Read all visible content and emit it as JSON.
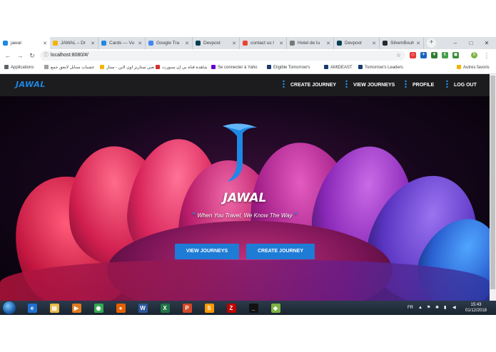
{
  "browser": {
    "tabs": [
      {
        "title": "jawal",
        "active": true,
        "color": "#1e88e5"
      },
      {
        "title": "JAWAL – Dr",
        "color": "#f4b400"
      },
      {
        "title": "Cards — Vu",
        "color": "#1e88e5"
      },
      {
        "title": "Google Tra",
        "color": "#4285f4"
      },
      {
        "title": "Devpost",
        "color": "#003e54"
      },
      {
        "title": "contact us l",
        "color": "#ea4335"
      },
      {
        "title": "Hotel de lu",
        "color": "#777777"
      },
      {
        "title": "Devpost",
        "color": "#003e54"
      },
      {
        "title": "SihemBouh",
        "color": "#24292e"
      }
    ],
    "url": "localhost:8080/#/",
    "bookmarks": [
      {
        "label": "Applications",
        "color": "#5f6368"
      },
      {
        "label": "عشبات سنابل لايعق جمع",
        "color": "#9e9e9e"
      },
      {
        "label": "العبي ستاربز اون لاين - ستار",
        "color": "#f4b400"
      },
      {
        "label": "مشاهدة قناة بي إن سبورت",
        "color": "#d32f2f"
      },
      {
        "label": "Se connecter à Yaho",
        "color": "#6001d2"
      },
      {
        "label": "Eligible Tomorrow's",
        "color": "#1a3c6e"
      },
      {
        "label": "AMIDEAST",
        "color": "#1a3c6e"
      },
      {
        "label": "Tomorrow's Leaders",
        "color": "#1a3c6e"
      },
      {
        "label": "Autres favoris",
        "color": "#f4b400"
      }
    ]
  },
  "site": {
    "brand": "JAWAL",
    "nav": [
      "CREATE JOURNEY",
      "VIEW JOURNEYS",
      "PROFILE",
      "LOG OUT"
    ],
    "hero_title": "JAWAL",
    "tagline": "When You Travel, We Know The Way",
    "buttons": {
      "view": "VIEW JOURNEYS",
      "create": "CREATE JOURNEY"
    },
    "accent": "#1e88e5"
  },
  "taskbar": {
    "apps": [
      {
        "name": "ie",
        "glyph": "e",
        "color": "#1f6fd1"
      },
      {
        "name": "explorer",
        "glyph": "▤",
        "color": "#e8b94a"
      },
      {
        "name": "media",
        "glyph": "▶",
        "color": "#e07a1f"
      },
      {
        "name": "chrome",
        "glyph": "◉",
        "color": "#34a853"
      },
      {
        "name": "firefox",
        "glyph": "●",
        "color": "#e66000"
      },
      {
        "name": "word",
        "glyph": "W",
        "color": "#2b579a"
      },
      {
        "name": "excel",
        "glyph": "X",
        "color": "#217346"
      },
      {
        "name": "powerpoint",
        "glyph": "P",
        "color": "#d24726"
      },
      {
        "name": "sublime",
        "glyph": "S",
        "color": "#ff9800"
      },
      {
        "name": "filezilla",
        "glyph": "Z",
        "color": "#bf0000"
      },
      {
        "name": "cmd",
        "glyph": "_",
        "color": "#111111"
      },
      {
        "name": "app",
        "glyph": "◆",
        "color": "#7cb342"
      }
    ],
    "lang": "FR",
    "time": "15:43",
    "date": "01/12/2018"
  }
}
